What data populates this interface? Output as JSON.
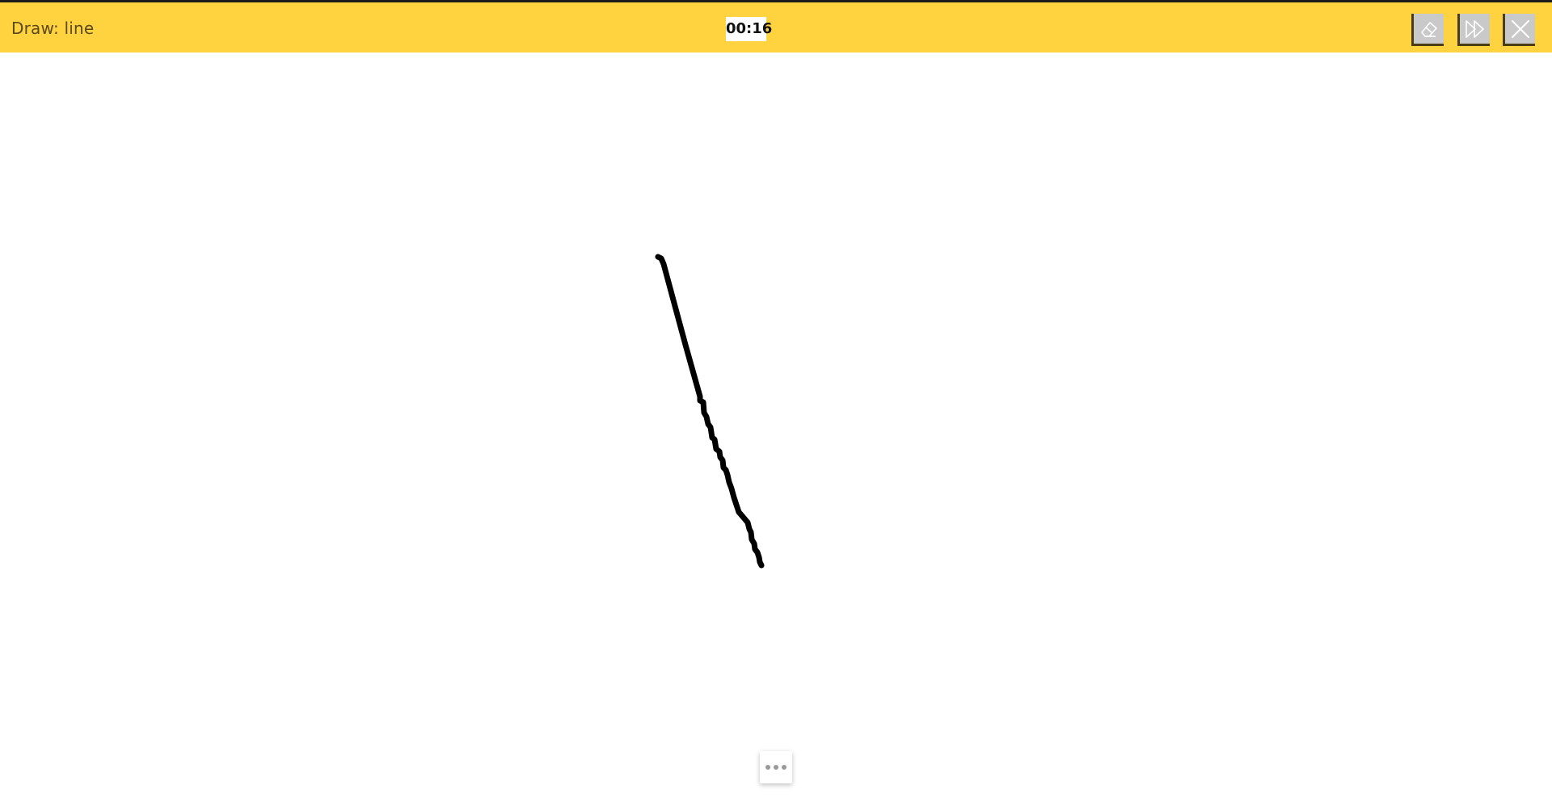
{
  "header": {
    "prompt": "Draw: line",
    "timer": "00:16"
  },
  "toolbar": {
    "buttons": [
      {
        "name": "eraser",
        "icon": "eraser-icon"
      },
      {
        "name": "skip",
        "icon": "fast-forward-icon"
      },
      {
        "name": "close",
        "icon": "close-icon"
      }
    ]
  },
  "canvas": {
    "stroke_color": "#000000",
    "background": "#ffffff"
  },
  "more_menu": {
    "icon": "more-dots-icon"
  },
  "colors": {
    "topbar": "#ffd23f",
    "button": "#c9c9c9",
    "button_shadow": "#4a3d14",
    "prompt_text": "#5a4a1a"
  }
}
